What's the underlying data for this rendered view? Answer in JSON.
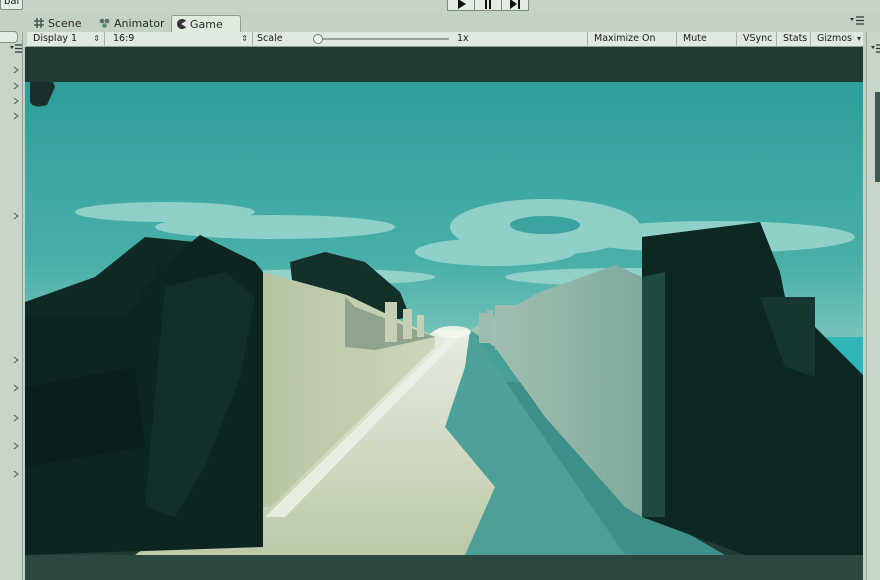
{
  "global_button": "bal",
  "play_controls": {
    "play_icon": "play-icon",
    "pause_icon": "pause-icon",
    "step_icon": "step-icon"
  },
  "tabs": [
    {
      "label": "Scene",
      "icon": "scene-grid-icon",
      "active": false
    },
    {
      "label": "Animator",
      "icon": "animator-icon",
      "active": false
    },
    {
      "label": "Game",
      "icon": "game-pacman-icon",
      "active": true
    }
  ],
  "game_toolbar": {
    "display": "Display 1",
    "aspect": "16:9",
    "scale_label": "Scale",
    "scale_value": "1x",
    "scale_level": 0.0,
    "maximize_on_play": "Maximize On Play",
    "mute_audio": "Mute Audio",
    "vsync": "VSync",
    "stats": "Stats",
    "gizmos": "Gizmos"
  },
  "colors": {
    "editor_bg": "#c2d2c4",
    "toolbar_bg": "#dfe9df",
    "sky": "#3aa6a2",
    "wall_dark": "#0f2a25",
    "floor_light": "#c7d3b7",
    "floor_shadow": "#3f9a92"
  }
}
